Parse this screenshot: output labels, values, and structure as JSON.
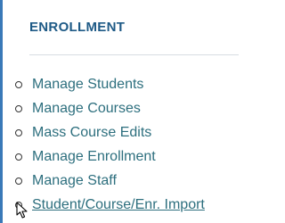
{
  "section": {
    "heading": "ENROLLMENT"
  },
  "menu": {
    "items": [
      {
        "label": "Manage Students"
      },
      {
        "label": "Manage Courses"
      },
      {
        "label": "Mass Course Edits"
      },
      {
        "label": "Manage Enrollment"
      },
      {
        "label": "Manage Staff"
      },
      {
        "label": "Student/Course/Enr. Import"
      }
    ]
  },
  "colors": {
    "heading": "#1e5a86",
    "link": "#2d6f7e",
    "panel_border": "#3a79b8"
  },
  "icons": {
    "bullet": "hollow-circle-bullet-icon",
    "cursor": "mouse-pointer-icon"
  }
}
